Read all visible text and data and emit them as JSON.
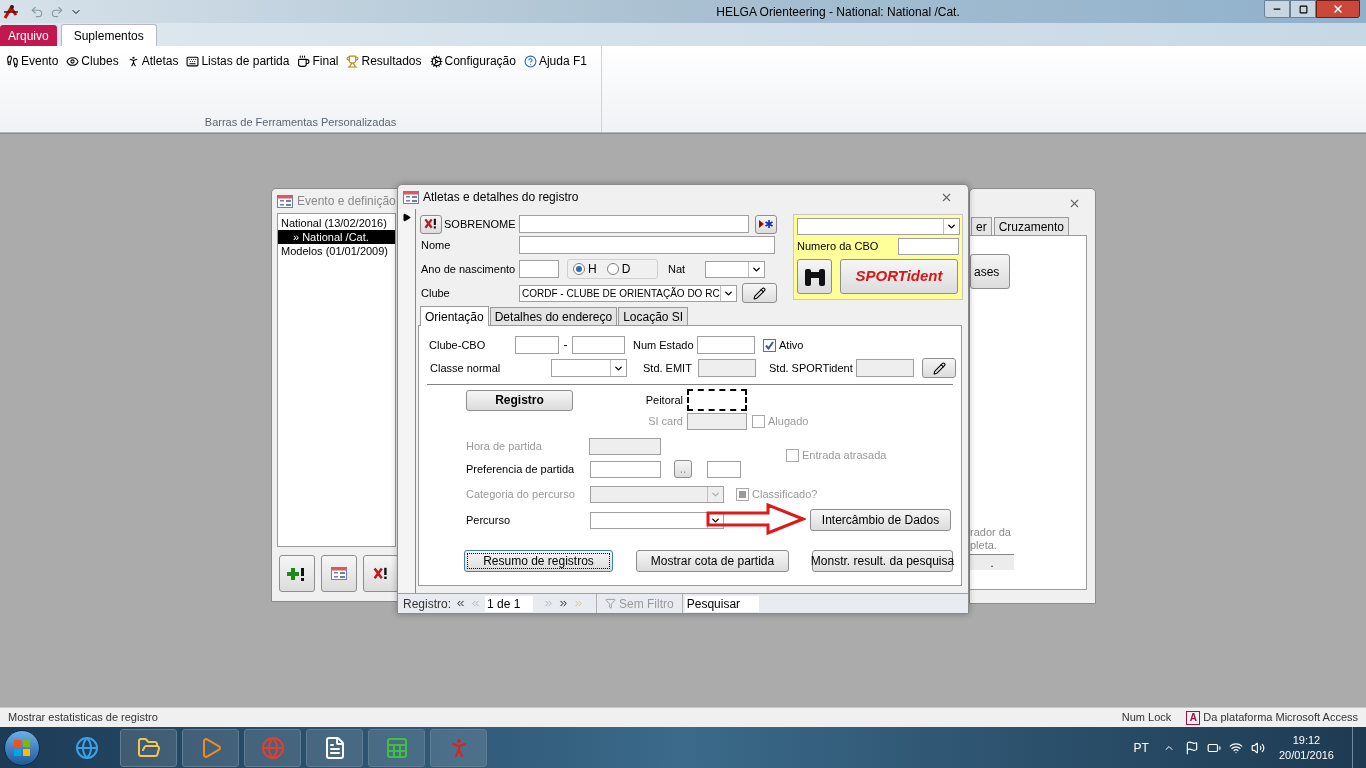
{
  "title_bar": {
    "title": "HELGA Orienteering - National: National /Cat."
  },
  "ribbon": {
    "tabs": [
      {
        "label": "Arquivo",
        "kind": "file",
        "selected": false
      },
      {
        "label": "Suplementos",
        "kind": "tab",
        "selected": true
      }
    ],
    "items": [
      "Evento",
      "Clubes",
      "Atletas",
      "Listas de partida",
      "Final",
      "Resultados",
      "Configuração",
      "Ajuda F1"
    ],
    "group_label": "Barras de Ferramentas Personalizadas"
  },
  "event_window": {
    "title": "Evento e definição",
    "tree": [
      {
        "label": "National (13/02/2016)",
        "selected": false,
        "children": [
          {
            "label": "» National /Cat.",
            "selected": true
          }
        ]
      },
      {
        "label": "Modelos (01/01/2009)",
        "selected": false
      }
    ]
  },
  "back_window": {
    "tabs": [
      {
        "label": "er",
        "selected": false
      },
      {
        "label": "Cruzamento",
        "selected": false
      }
    ],
    "button": "ases",
    "note_lines": [
      "rador da",
      "pleta."
    ],
    "cell": "."
  },
  "athlete_window": {
    "title": "Atletas e detalhes do registro",
    "header": {
      "surname_label": "SOBRENOME",
      "name_label": "Nome",
      "birth_year_label": "Ano de nascimento",
      "gender_options": [
        {
          "label": "H",
          "selected": true
        },
        {
          "label": "D",
          "selected": false
        }
      ],
      "nationality_label": "Nat",
      "club_label": "Clube",
      "club_value": "CORDF - CLUBE DE ORIENTAÇÃO DO RC"
    },
    "si_panel": {
      "cbo_label": "Numero da CBO",
      "sportident_button": "SPORTident"
    },
    "tabs": [
      {
        "label": "Orientação",
        "selected": true
      },
      {
        "label": "Detalhes do endereço",
        "selected": false
      },
      {
        "label": "Locação SI",
        "selected": false
      }
    ],
    "orientation": {
      "club_cbo_label": "Clube-CBO",
      "separator": "-",
      "state_number_label": "Num Estado",
      "active": {
        "label": "Ativo",
        "checked": true
      },
      "class_label": "Classe normal",
      "emit_label": "Std. EMIT",
      "sportident_label": "Std. SPORTident",
      "register_button": "Registro",
      "bib_label": "Peitoral",
      "si_card": {
        "label": "SI card",
        "disabled": true
      },
      "rented": {
        "label": "Alugado",
        "checked": false,
        "disabled": true
      },
      "start_time": {
        "label": "Hora de partida",
        "disabled": true
      },
      "start_pref": {
        "label": "Preferencia de partida",
        "disabled": false
      },
      "pick_button": "..",
      "late_entry": {
        "label": "Entrada atrasada",
        "checked": false,
        "disabled": true
      },
      "course_category": {
        "label": "Categoria do percurso",
        "disabled": true
      },
      "classified": {
        "label": "Classificado?",
        "checked": false,
        "indeterminate": true,
        "disabled": true
      },
      "course": {
        "label": "Percurso",
        "disabled": false
      },
      "data_exchange_button": "Intercâmbio de Dados",
      "buttons": [
        {
          "label": "Resumo de registros",
          "focused": true
        },
        {
          "label": "Mostrar cota de partida",
          "focused": false
        },
        {
          "label": "Monstr. result. da pesquisa",
          "focused": false
        }
      ]
    },
    "nav": {
      "label": "Registro:",
      "position": "1 de 1",
      "filter": "Sem Filtro",
      "search_placeholder": "Pesquisar"
    }
  },
  "status_bar": {
    "text": "Mostrar estatisticas de registro",
    "num_lock": "Num Lock",
    "platform_badge": "A",
    "platform": "Da plataforma Microsoft Access"
  },
  "taskbar": {
    "language": "PT",
    "time": "19:12",
    "date": "20/01/2016"
  }
}
